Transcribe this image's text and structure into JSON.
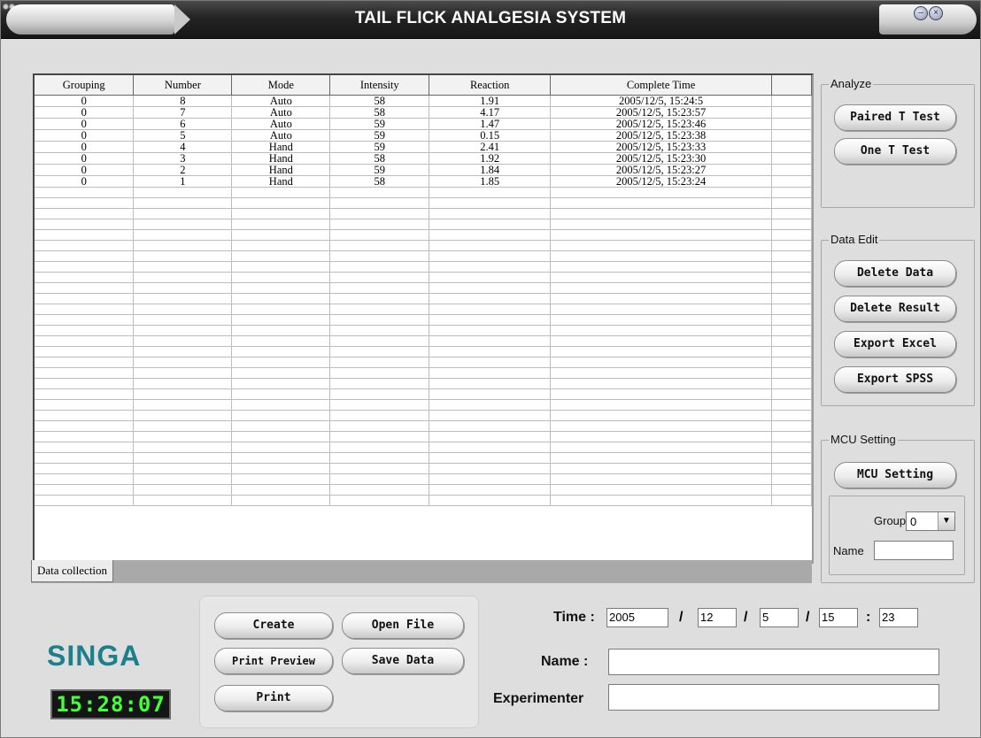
{
  "app": {
    "title": "TAIL FLICK ANALGESIA SYSTEM",
    "minimize_icon": "minimize-icon",
    "close_icon": "close-icon"
  },
  "grid": {
    "columns": [
      "Grouping",
      "Number",
      "Mode",
      "Intensity",
      "Reaction",
      "Complete Time"
    ],
    "rows": [
      {
        "grouping": "0",
        "number": "8",
        "mode": "Auto",
        "intensity": "58",
        "reaction": "1.91",
        "time": "2005/12/5, 15:24:5"
      },
      {
        "grouping": "0",
        "number": "7",
        "mode": "Auto",
        "intensity": "58",
        "reaction": "4.17",
        "time": "2005/12/5, 15:23:57"
      },
      {
        "grouping": "0",
        "number": "6",
        "mode": "Auto",
        "intensity": "59",
        "reaction": "1.47",
        "time": "2005/12/5, 15:23:46"
      },
      {
        "grouping": "0",
        "number": "5",
        "mode": "Auto",
        "intensity": "59",
        "reaction": "0.15",
        "time": "2005/12/5, 15:23:38"
      },
      {
        "grouping": "0",
        "number": "4",
        "mode": "Hand",
        "intensity": "59",
        "reaction": "2.41",
        "time": "2005/12/5, 15:23:33"
      },
      {
        "grouping": "0",
        "number": "3",
        "mode": "Hand",
        "intensity": "58",
        "reaction": "1.92",
        "time": "2005/12/5, 15:23:30"
      },
      {
        "grouping": "0",
        "number": "2",
        "mode": "Hand",
        "intensity": "59",
        "reaction": "1.84",
        "time": "2005/12/5, 15:23:27"
      },
      {
        "grouping": "0",
        "number": "1",
        "mode": "Hand",
        "intensity": "58",
        "reaction": "1.85",
        "time": "2005/12/5, 15:23:24"
      }
    ],
    "tab_label": "Data collection"
  },
  "analyze": {
    "legend": "Analyze",
    "paired_t": "Paired T Test",
    "one_t": "One T Test"
  },
  "data_edit": {
    "legend": "Data Edit",
    "delete_data": "Delete Data",
    "delete_result": "Delete Result",
    "export_excel": "Export Excel",
    "export_spss": "Export SPSS"
  },
  "mcu": {
    "legend": "MCU Setting",
    "button": "MCU Setting",
    "group_label": "Group",
    "group_value": "0",
    "name_label": "Name",
    "name_value": ""
  },
  "brand": {
    "logo": "SINGA",
    "clock": "15:28:07"
  },
  "file_buttons": {
    "create": "Create",
    "open_file": "Open File",
    "print_preview": "Print Preview",
    "save_data": "Save Data",
    "print": "Print"
  },
  "info": {
    "time_label": "Time :",
    "year": "2005",
    "month": "12",
    "day": "5",
    "hour": "15",
    "minute": "23",
    "slash": "/",
    "colon": ":",
    "name_label": "Name :",
    "name_value": "",
    "experimenter_label": "Experimenter",
    "experimenter_value": ""
  },
  "colors": {
    "accent_logo": "#1b7f8c",
    "clock_digits": "#43ff38",
    "titlebar": "#1c1c1c"
  }
}
